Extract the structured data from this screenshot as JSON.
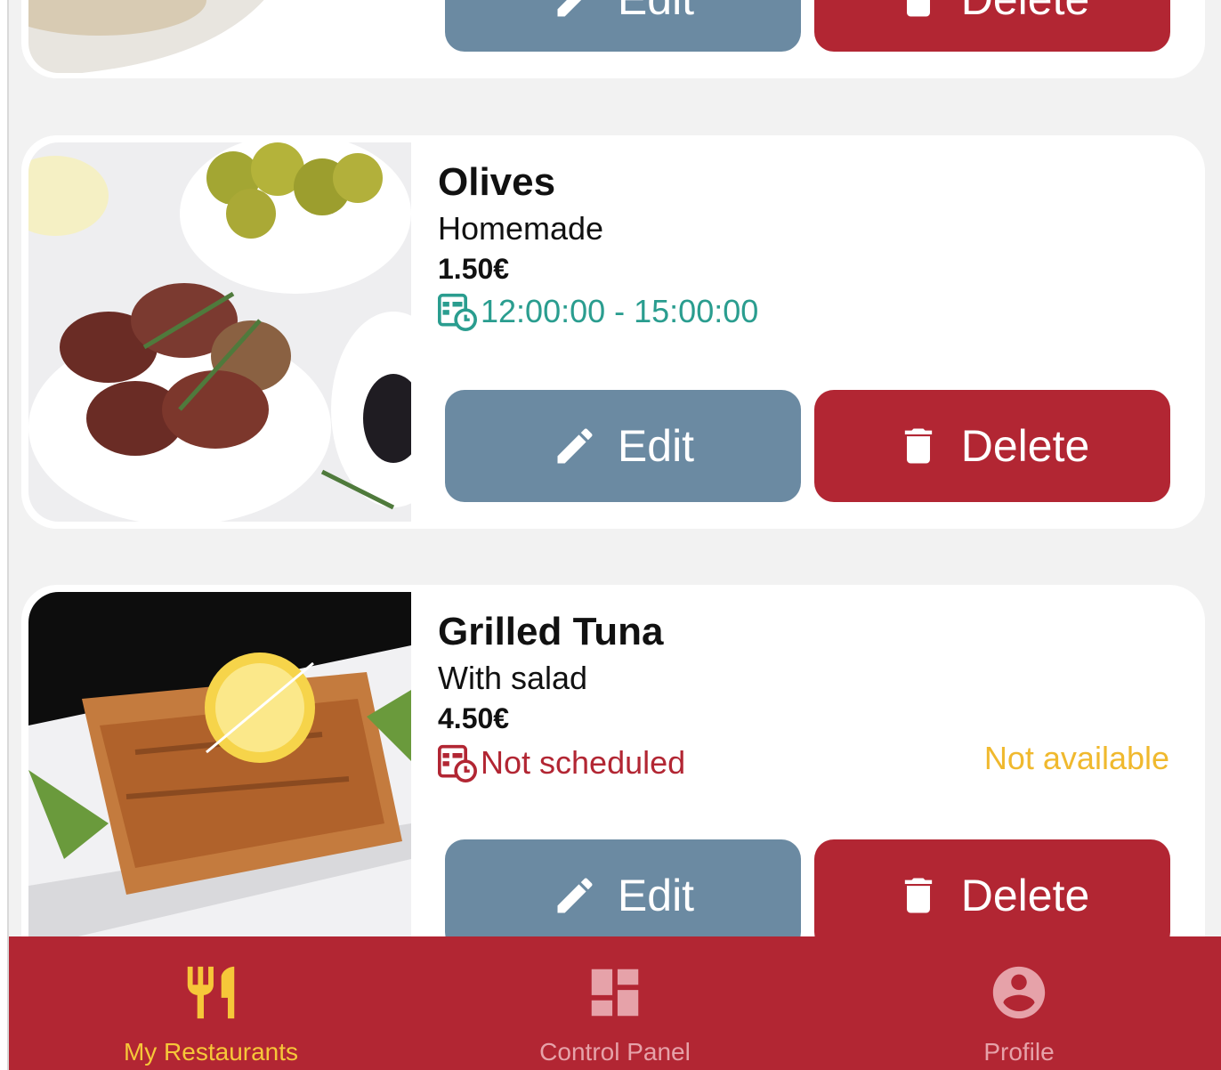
{
  "colors": {
    "edit": "#6b8aa2",
    "delete": "#b22633",
    "scheduled": "#2a9d8f",
    "not_scheduled": "#b22633",
    "not_available": "#f0b92e",
    "tab_active": "#f6c739",
    "tab_inactive": "#e6a2a9"
  },
  "items": [
    {
      "name": "",
      "edit_label": "Edit",
      "delete_label": "Delete"
    },
    {
      "name": "Olives",
      "description": "Homemade",
      "price": "1.50€",
      "schedule": "12:00:00 - 15:00:00",
      "schedule_icon": "calendar-clock-icon",
      "edit_label": "Edit",
      "delete_label": "Delete"
    },
    {
      "name": "Grilled Tuna",
      "description": "With salad",
      "price": "4.50€",
      "schedule": "Not scheduled",
      "schedule_icon": "calendar-clock-icon",
      "status": "Not available",
      "edit_label": "Edit",
      "delete_label": "Delete"
    }
  ],
  "tabs": [
    {
      "label": "My Restaurants",
      "icon": "cutlery-icon",
      "active": true
    },
    {
      "label": "Control Panel",
      "icon": "dashboard-icon",
      "active": false
    },
    {
      "label": "Profile",
      "icon": "account-circle-icon",
      "active": false
    }
  ]
}
